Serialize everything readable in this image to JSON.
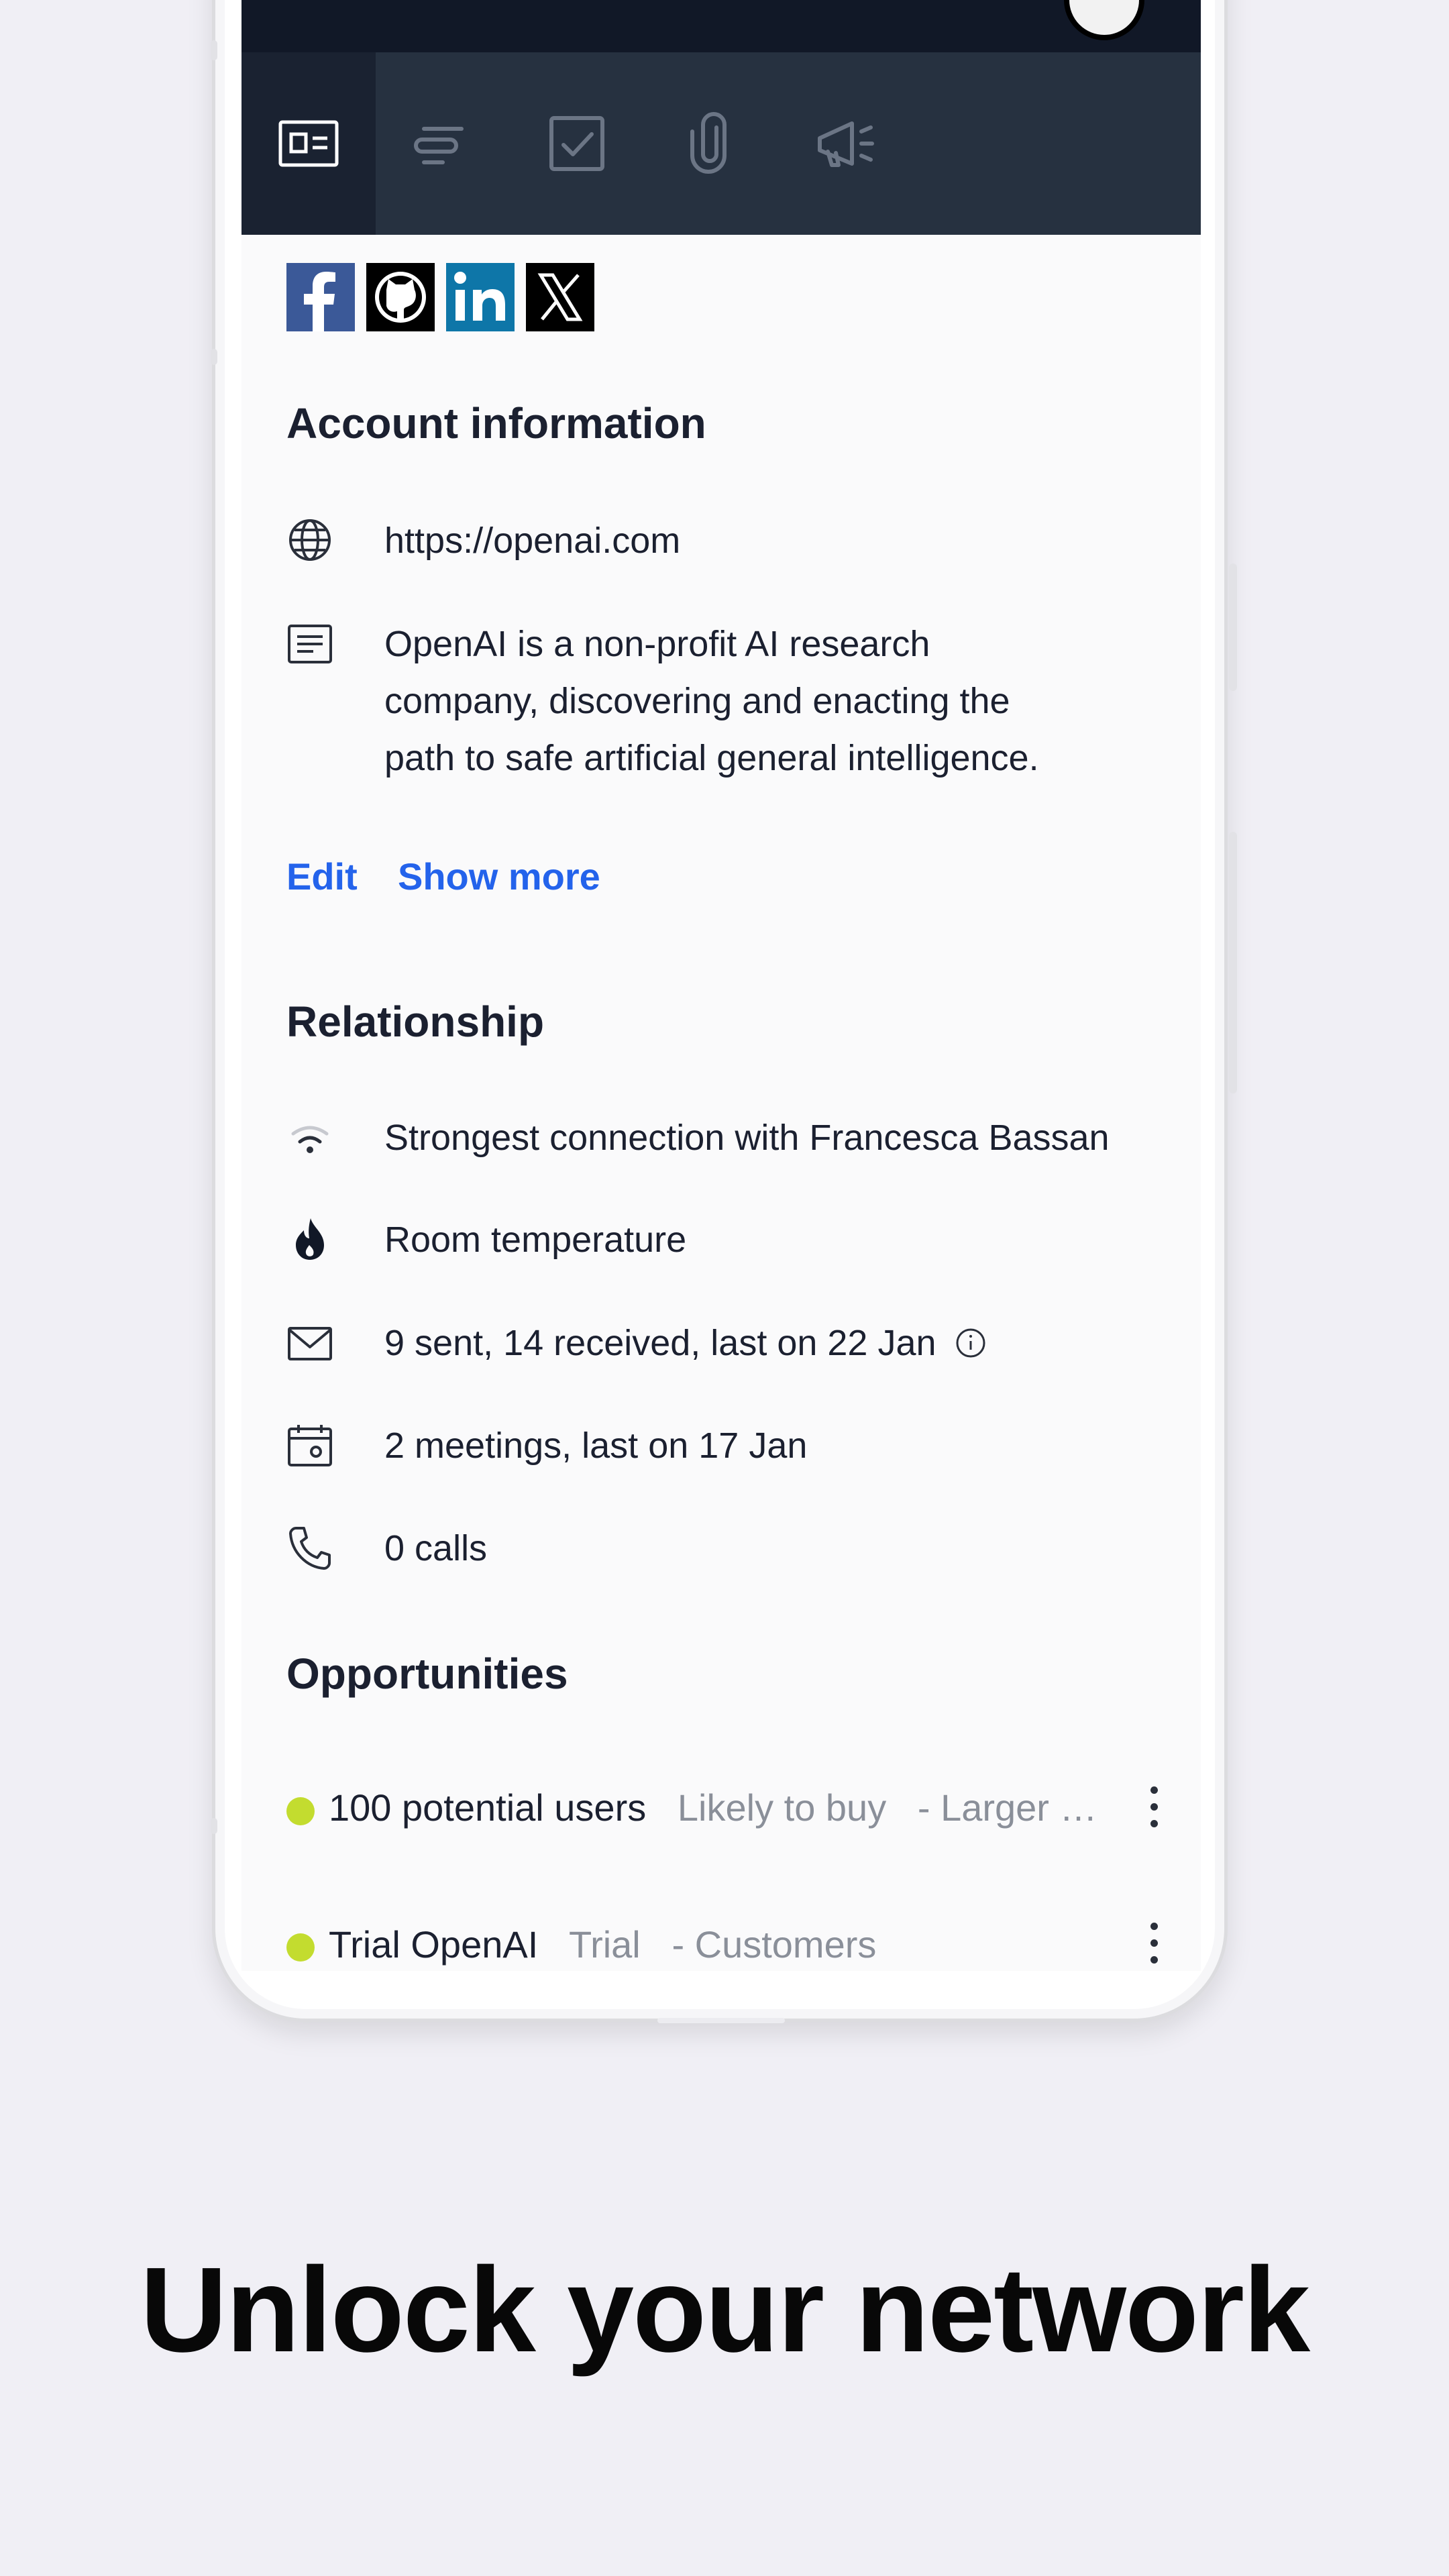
{
  "tabs": [
    {
      "id": "overview",
      "icon": "contact-card-icon",
      "active": true
    },
    {
      "id": "activity",
      "icon": "timeline-icon",
      "active": false
    },
    {
      "id": "tasks",
      "icon": "checkbox-icon",
      "active": false
    },
    {
      "id": "attachments",
      "icon": "paperclip-icon",
      "active": false
    },
    {
      "id": "campaigns",
      "icon": "megaphone-icon",
      "active": false
    }
  ],
  "social": [
    "facebook-icon",
    "github-icon",
    "linkedin-icon",
    "x-icon"
  ],
  "account": {
    "title": "Account information",
    "website": "https://openai.com",
    "description_lines": [
      "OpenAI is a non-profit AI research",
      "company, discovering and enacting the",
      "path to safe artificial general intelligence."
    ],
    "edit_label": "Edit",
    "show_more_label": "Show more"
  },
  "relationship": {
    "title": "Relationship",
    "connection": "Strongest connection with Francesca Bassan",
    "temperature": "Room temperature",
    "emails": "9 sent, 14 received, last on 22 Jan",
    "meetings": "2 meetings, last on 17 Jan",
    "calls": "0 calls"
  },
  "opportunities": {
    "title": "Opportunities",
    "items": [
      {
        "name": "100 potential users",
        "stage": "Likely to buy",
        "pipeline": "- Larger …",
        "status_color": "#c3dc2f"
      },
      {
        "name": "Trial OpenAI",
        "stage": "Trial",
        "pipeline": "- Customers",
        "status_color": "#c3dc2f"
      }
    ]
  },
  "tagline": "Unlock your network",
  "colors": {
    "accent": "#2463eb",
    "header": "#263140",
    "status_dot": "#c3dc2f"
  }
}
